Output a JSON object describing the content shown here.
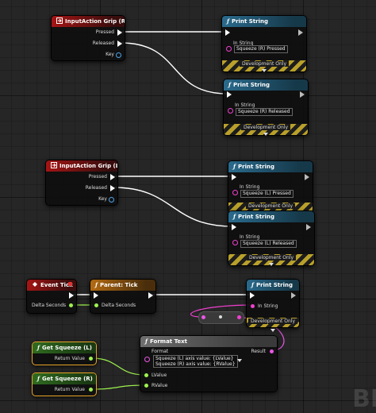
{
  "colors": {
    "event_header": "#a51515",
    "function_header": "#2a6a8c",
    "pure_header": "#2f6b20",
    "exec_pin": "#ffffff",
    "key_pin": "#4fa3e8",
    "float_pin": "#9ef24f",
    "text_pin": "#ea57e6",
    "string_pin": "#f040d0",
    "selection": "#e8a427"
  },
  "nodes": {
    "grip_r": {
      "title": "InputAction Grip (R)",
      "icon": "input-event-icon",
      "pins": {
        "pressed": "Pressed",
        "released": "Released",
        "key": "Key"
      }
    },
    "print_r_pressed": {
      "title": "Print String",
      "in_string_label": "In String",
      "in_string_value": "Squeeze (R) Pressed",
      "dev_only": "Development Only"
    },
    "print_r_released": {
      "title": "Print String",
      "in_string_label": "In String",
      "in_string_value": "Squeeze (R) Released",
      "dev_only": "Development Only"
    },
    "grip_l": {
      "title": "InputAction Grip (L)",
      "icon": "input-event-icon",
      "pins": {
        "pressed": "Pressed",
        "released": "Released",
        "key": "Key"
      }
    },
    "print_l_pressed": {
      "title": "Print String",
      "in_string_label": "In String",
      "in_string_value": "Squeeze (L) Pressed",
      "dev_only": "Development Only"
    },
    "print_l_released": {
      "title": "Print String",
      "in_string_label": "In String",
      "in_string_value": "Squeeze (L) Released",
      "dev_only": "Development Only"
    },
    "event_tick": {
      "title": "Event Tick",
      "delta_label": "Delta Seconds"
    },
    "parent_tick": {
      "title": "Parent: Tick",
      "delta_label": "Delta Seconds"
    },
    "print_tick": {
      "title": "Print String",
      "in_string_label": "In String",
      "dev_only": "Development Only"
    },
    "get_squeeze_l": {
      "title": "Get Squeeze (L)",
      "return_label": "Return Value"
    },
    "get_squeeze_r": {
      "title": "Get Squeeze (R)",
      "return_label": "Return Value"
    },
    "format_text": {
      "title": "Format Text",
      "format_label": "Format",
      "format_line1": "Squeeze (L) axis value: {LValue}",
      "format_line2": "Squeeze (R) axis value: {RValue}",
      "result_label": "Result",
      "lvalue_label": "LValue",
      "rvalue_label": "RValue"
    }
  },
  "watermark": "BI"
}
